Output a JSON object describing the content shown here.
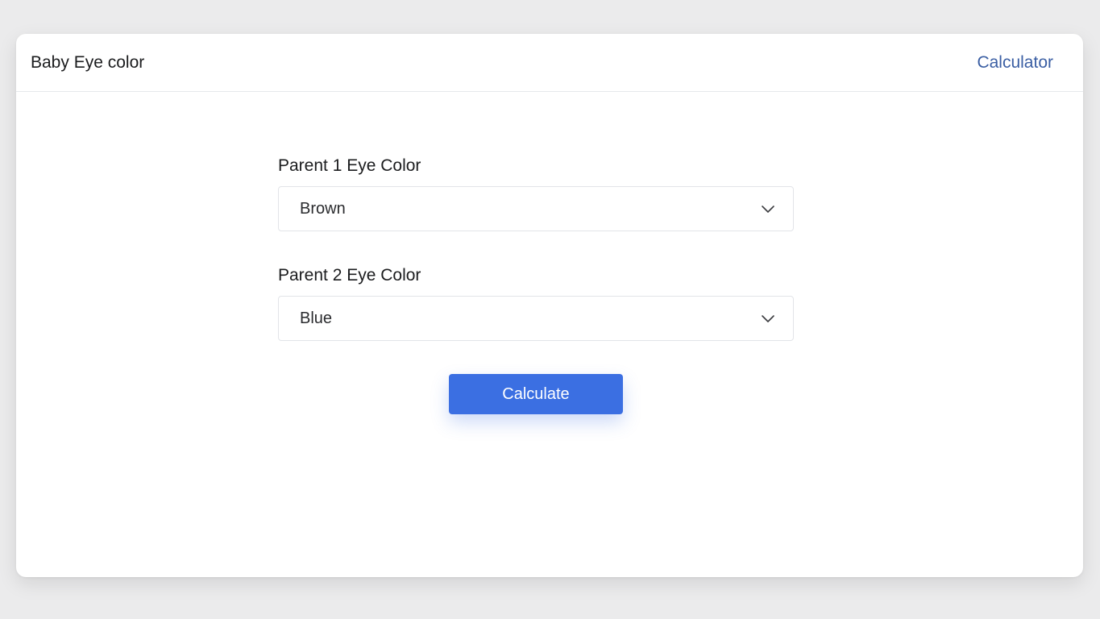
{
  "header": {
    "title": "Baby Eye color",
    "nav_link": "Calculator"
  },
  "form": {
    "parent1": {
      "label": "Parent 1 Eye Color",
      "selected": "Brown"
    },
    "parent2": {
      "label": "Parent 2 Eye Color",
      "selected": "Blue"
    },
    "submit_label": "Calculate"
  },
  "colors": {
    "accent": "#3b6fe2",
    "link": "#3a5ea3"
  },
  "icons": {
    "select_arrow": "chevron-down-icon"
  }
}
